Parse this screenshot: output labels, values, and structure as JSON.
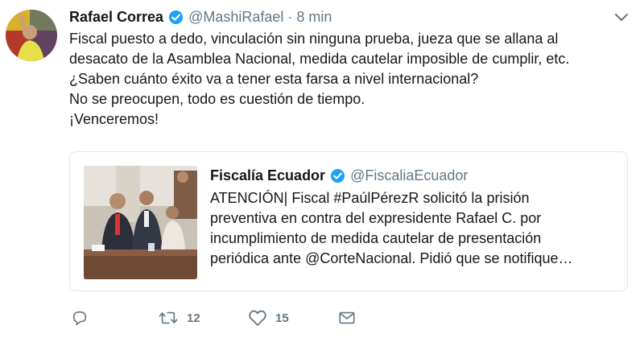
{
  "tweet": {
    "author_name": "Rafael Correa",
    "handle": "@MashiRafael",
    "separator": "·",
    "time": "8 min",
    "lines": [
      "Fiscal puesto a dedo, vinculación sin ninguna prueba, jueza que se allana al",
      "desacato de la Asamblea Nacional, medida cautelar imposible de cumplir, etc.",
      "¿Saben cuánto éxito va a tener esta farsa a nivel internacional?",
      "No se preocupen, todo es cuestión de tiempo.",
      "¡Venceremos!"
    ]
  },
  "quoted": {
    "author_name": "Fiscalía Ecuador",
    "handle": "@FiscaliaEcuador",
    "lines": [
      "ATENCIÓN| Fiscal #PaúlPérezR solicitó la prisión",
      "preventiva en contra del expresidente Rafael C. por",
      "incumplimiento de medida cautelar de presentación",
      "periódica ante @CorteNacional. Pidió que se notifique…"
    ]
  },
  "actions": {
    "reply_icon": "reply-icon",
    "retweet_icon": "retweet-icon",
    "retweet_count": "12",
    "like_icon": "heart-icon",
    "like_count": "15",
    "dm_icon": "envelope-icon"
  },
  "colors": {
    "verified_blue": "#1da1f2",
    "secondary_text": "#657786",
    "border": "#e1e8ed"
  }
}
